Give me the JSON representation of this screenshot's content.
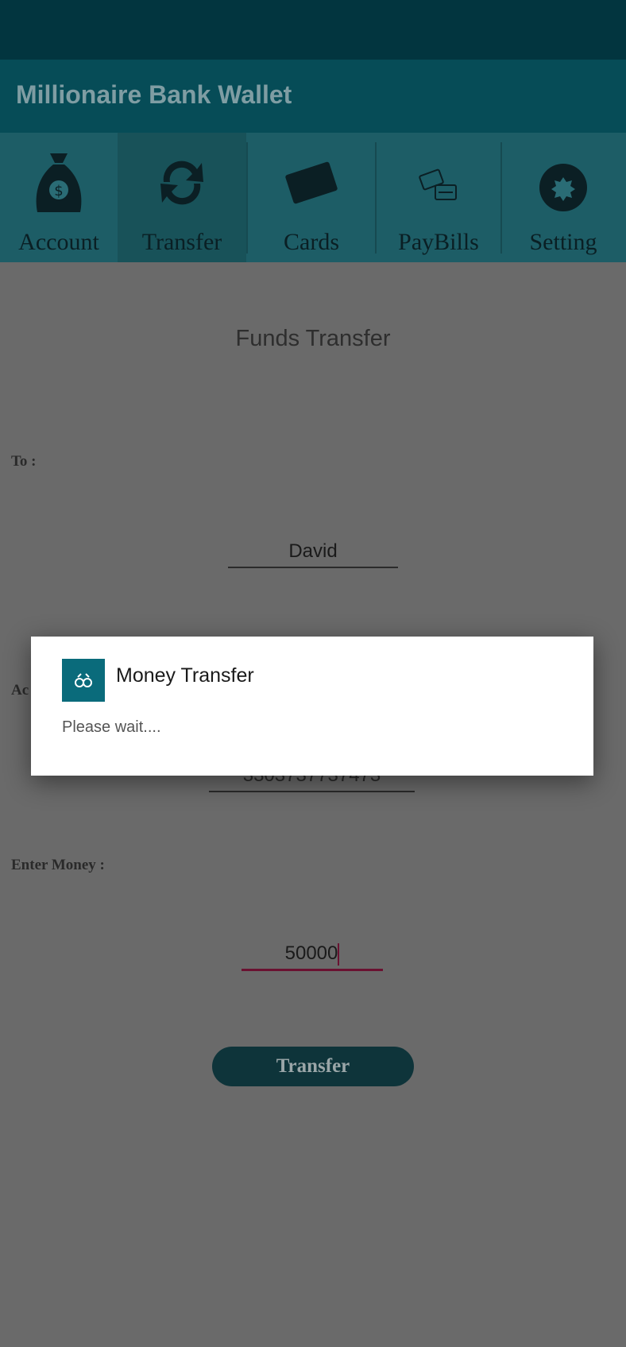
{
  "app": {
    "title": "Millionaire Bank Wallet"
  },
  "tabs": [
    {
      "label": "Account",
      "icon": "money-bag-icon",
      "selected": false
    },
    {
      "label": "Transfer",
      "icon": "refresh-icon",
      "selected": true
    },
    {
      "label": "Cards",
      "icon": "card-icon",
      "selected": false
    },
    {
      "label": "PayBills",
      "icon": "pay-bills-icon",
      "selected": false
    },
    {
      "label": "Setting",
      "icon": "gear-icon",
      "selected": false
    }
  ],
  "form": {
    "heading": "Funds Transfer",
    "to_label": "To :",
    "to_value": "David",
    "account_value": "3303737737473",
    "money_label": "Enter Money :",
    "money_value": "50000",
    "submit_label": "Transfer"
  },
  "dialog": {
    "title": "Money Transfer",
    "message": "Please wait....",
    "icon": "app-icon"
  },
  "colors": {
    "statusbar": "#02353f",
    "appbar": "#064c57",
    "tabs": "#1d5d66",
    "accent": "#0a6b7b",
    "input_focus": "#6a1131"
  }
}
